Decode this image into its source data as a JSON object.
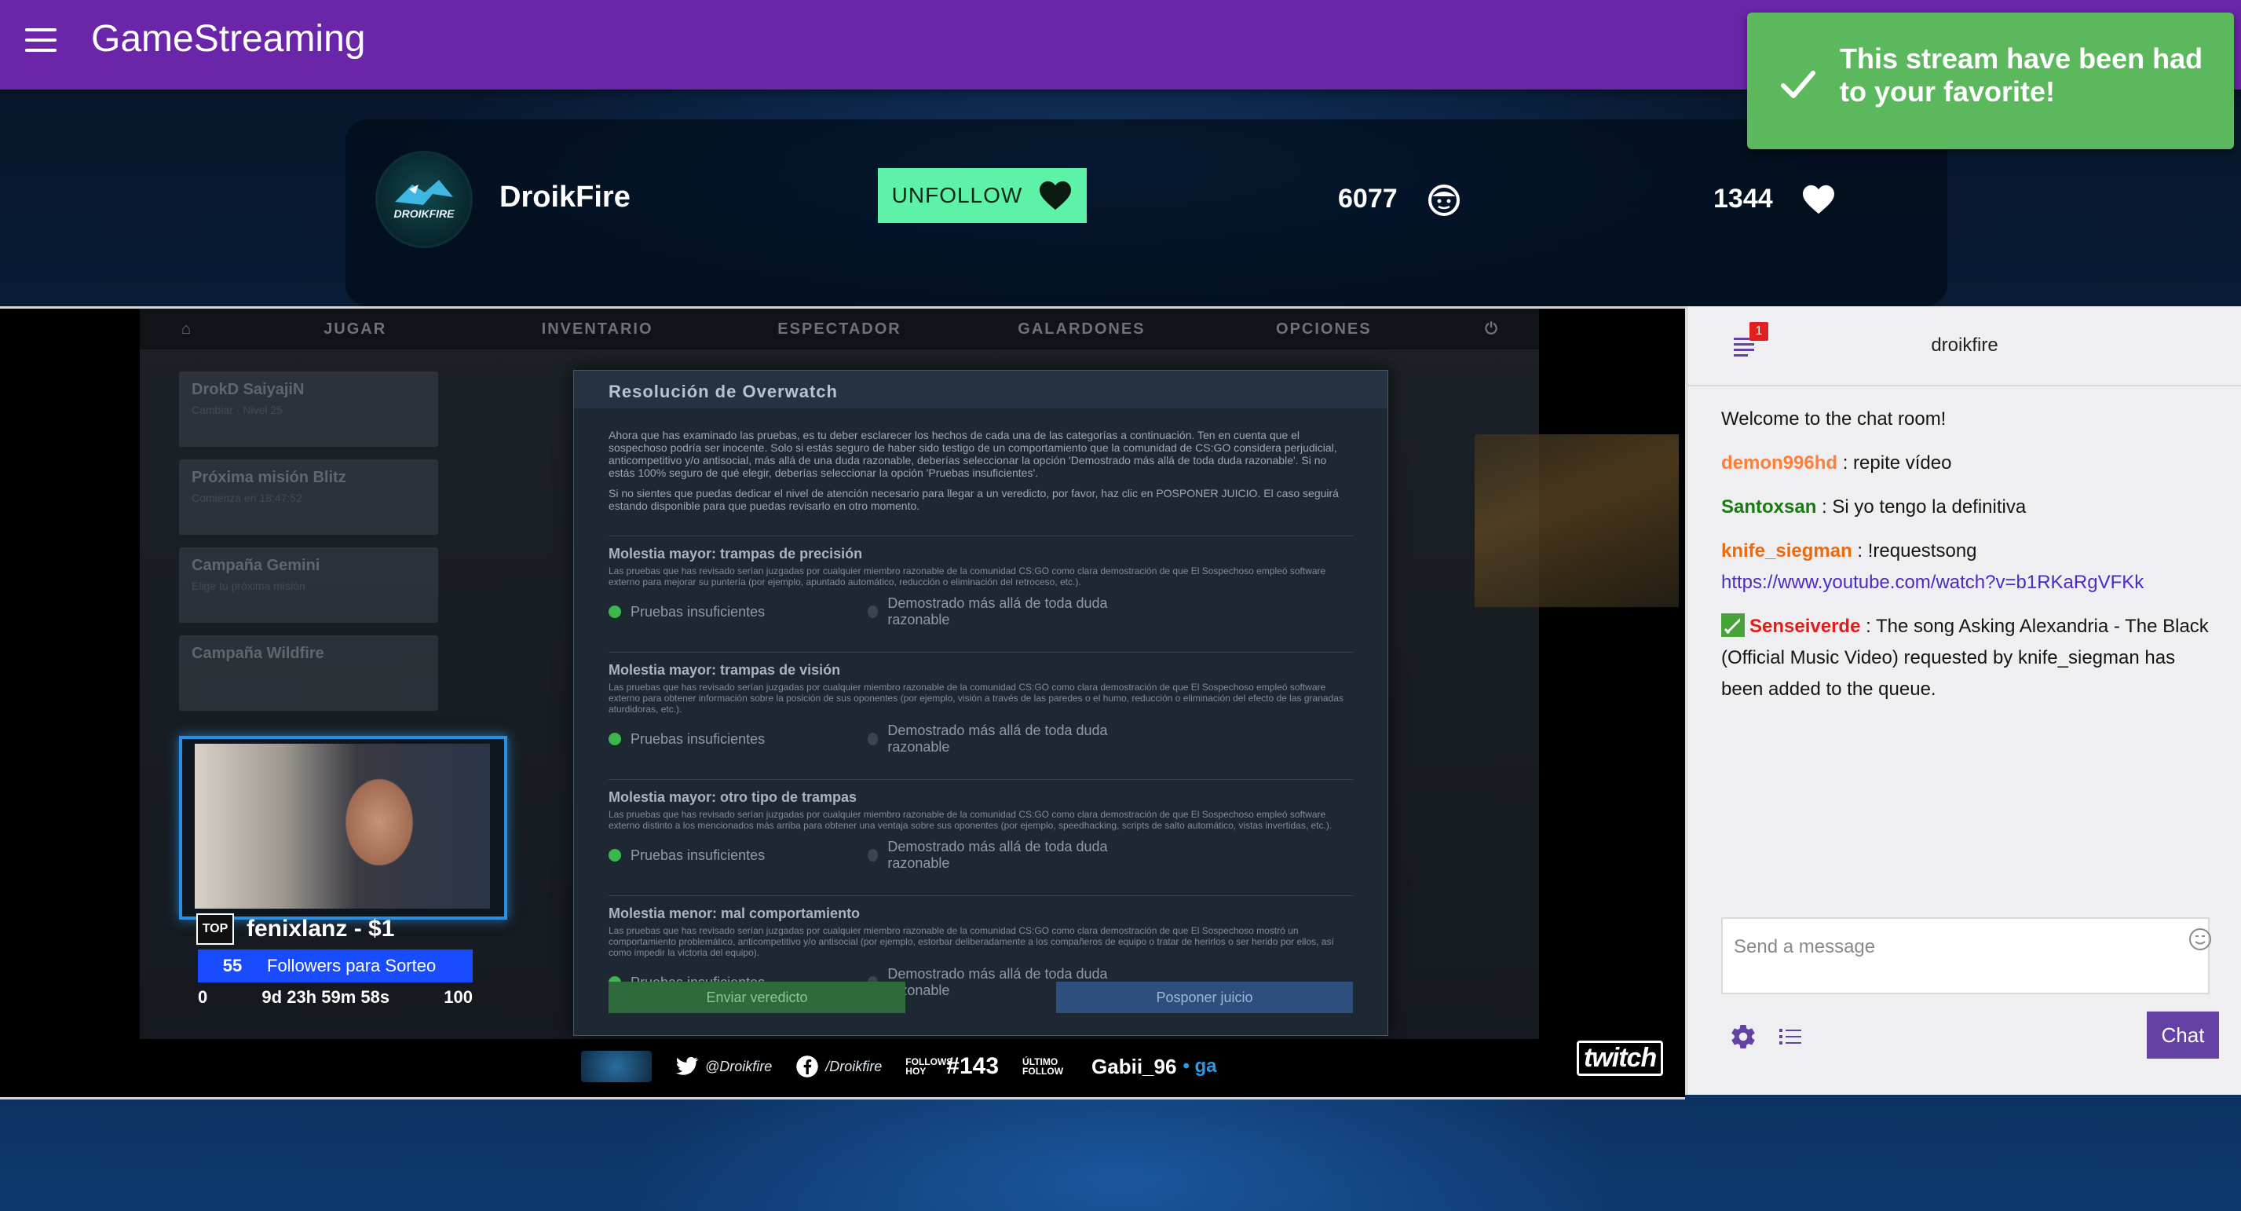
{
  "app": {
    "title": "GameStreaming",
    "colors": {
      "appbar": "#6b25a8",
      "toast": "#5cb85c",
      "unfollow": "#5ef2a8",
      "chat_button": "#6441a5"
    }
  },
  "toast": {
    "message": "This stream have been had to your favorite!",
    "icon": "check-icon"
  },
  "streamer": {
    "name": "DroikFire",
    "avatar_text": "DROIKFIRE",
    "unfollow_label": "UNFOLLOW",
    "viewers": "6077",
    "followers": "1344"
  },
  "video": {
    "game_nav": [
      "JUGAR",
      "INVENTARIO",
      "ESPECTADOR",
      "GALARDONES",
      "OPCIONES"
    ],
    "side_rows": [
      {
        "title": "DrokD SaiyajiN",
        "sub": "Cambiar · Nivel 25"
      },
      {
        "title": "Próxima misión Blitz",
        "sub": "Comienza en 18:47:52"
      },
      {
        "title": "Campaña Gemini",
        "sub": "Elige tu próxima misión"
      },
      {
        "title": "Campaña Wildfire",
        "sub": ""
      }
    ],
    "dialog": {
      "title": "Resolución de Overwatch",
      "intro_1": "Ahora que has examinado las pruebas, es tu deber esclarecer los hechos de cada una de las categorías a continuación. Ten en cuenta que el sospechoso podría ser inocente. Solo si estás seguro de haber sido testigo de un comportamiento que la comunidad de CS:GO considera perjudicial, anticompetitivo y/o antisocial, más allá de una duda razonable, deberías seleccionar la opción 'Demostrado más allá de toda duda razonable'. Si no estás 100% seguro de qué elegir, deberías seleccionar la opción 'Pruebas insuficientes'.",
      "intro_2": "Si no sientes que puedas dedicar el nivel de atención necesario para llegar a un veredicto, por favor, haz clic en POSPONER JUICIO. El caso seguirá estando disponible para que puedas revisarlo en otro momento.",
      "option_insufficient": "Pruebas insuficientes",
      "option_proven": "Demostrado más allá de toda duda razonable",
      "sections": [
        {
          "title": "Molestia mayor: trampas de precisión",
          "desc": "Las pruebas que has revisado serían juzgadas por cualquier miembro razonable de la comunidad CS:GO como clara demostración de que El Sospechoso empleó software externo para mejorar su puntería (por ejemplo, apuntado automático, reducción o eliminación del retroceso, etc.)."
        },
        {
          "title": "Molestia mayor: trampas de visión",
          "desc": "Las pruebas que has revisado serían juzgadas por cualquier miembro razonable de la comunidad CS:GO como clara demostración de que El Sospechoso empleó software externo para obtener información sobre la posición de sus oponentes (por ejemplo, visión a través de las paredes o el humo, reducción o eliminación del efecto de las granadas aturdidoras, etc.)."
        },
        {
          "title": "Molestia mayor: otro tipo de trampas",
          "desc": "Las pruebas que has revisado serían juzgadas por cualquier miembro razonable de la comunidad CS:GO como clara demostración de que El Sospechoso empleó software externo distinto a los mencionados más arriba para obtener una ventaja sobre sus oponentes (por ejemplo, speedhacking, scripts de salto automático, vistas invertidas, etc.)."
        },
        {
          "title": "Molestia menor: mal comportamiento",
          "desc": "Las pruebas que has revisado serían juzgadas por cualquier miembro razonable de la comunidad CS:GO como clara demostración de que El Sospechoso mostró un comportamiento problemático, anticompetitivo y/o antisocial (por ejemplo, estorbar deliberadamente a los compañeros de equipo o tratar de herirlos o ser herido por ellos, así como impedir la victoria del equipo)."
        }
      ],
      "submit_label": "Enviar veredicto",
      "postpone_label": "Posponer juicio"
    },
    "donor": {
      "badge": "TOP",
      "text": "fenixlanz - $1"
    },
    "sorteo": {
      "count": "55",
      "label": "Followers para Sorteo",
      "min": "0",
      "timer": "9d 23h 59m 58s",
      "max": "100"
    },
    "overlay": {
      "twitter": "@Droikfire",
      "facebook": "/Droikfire",
      "hoy_label": "FOLLOWS HOY",
      "hoy_value": "#143",
      "last_follow_label": "ÚLTIMO FOLLOW",
      "last_follow_value": "Gabii_96",
      "extra": "• ga"
    },
    "twitch_logo": "twitch"
  },
  "chat": {
    "room_name": "droikfire",
    "badge_count": "1",
    "messages": [
      {
        "type": "system",
        "text": "Welcome to the chat room!"
      },
      {
        "type": "msg",
        "nick": "demon996hd",
        "color": "#ff7f3a",
        "text": "repite vídeo"
      },
      {
        "type": "msg",
        "nick": "Santoxsan",
        "color": "#1a7a12",
        "text": "Si yo tengo la definitiva"
      },
      {
        "type": "msg",
        "nick": "knife_siegman",
        "color": "#ea6a10",
        "text": "!requestsong",
        "link": "https://www.youtube.com/watch?v=b1RKaRgVFKk"
      },
      {
        "type": "msg",
        "nick": "Senseiverde",
        "color": "#e41b1b",
        "text": "The song Asking Alexandria - The Black (Official Music Video) requested by knife_siegman has been added to the queue.",
        "mod": true
      }
    ],
    "input_placeholder": "Send a message",
    "send_label": "Chat"
  }
}
